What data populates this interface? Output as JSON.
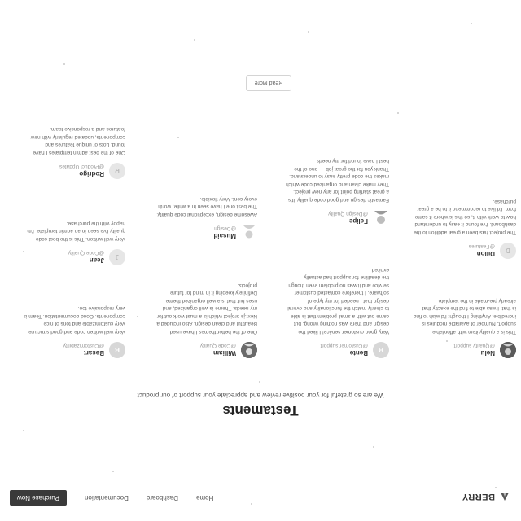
{
  "header": {
    "logo_text": "BERRY",
    "nav": [
      "Home",
      "Dashboard",
      "Documentation"
    ],
    "purchase_label": "Purchase Now"
  },
  "section": {
    "title": "Testaments",
    "subtitle": "We are so grateful for your positive review and appreciate your support of our product"
  },
  "testimonials": [
    {
      "initial": "",
      "name": "Nelu",
      "role": "@Quality support",
      "text": "This is a quality item with affordable support. Number of available modules is incredible. Anything I thought I'd wish to find is that. I was able to find the exactly that already pre-made in the template."
    },
    {
      "initial": "B",
      "name": "Bente",
      "role": "@Customer support",
      "text": "Very good customer service! I liked the design and there was nothing wrong, but came out with a small problem that is able to clearly match the functionality and overall design that I needed for my type of software. I therefore contacted customer service and it was no problem even though the deadline for support had actually expired."
    },
    {
      "initial": "",
      "name": "William",
      "role": "@Code Quality",
      "text": "One of the better themes I have used. Beautiful and clean design. Also included a Next.js project which is a must work out for my needs. Theme is well organized, and uses but that is a well organized theme. Definitely keeping it in mind for future projects."
    },
    {
      "initial": "B",
      "name": "Besart",
      "role": "@Customizability",
      "text": "Very well written code and good structure. Very customizable and tons of nice components. Good documentation. Team is very responsive too."
    },
    {
      "initial": "D",
      "name": "Dillon",
      "role": "@Features",
      "text": "The project has been a great addition to the dashboard. I've found it easy to understand how to work with it, so this is where it came from. I'd like to recommend it to be a great purchase."
    },
    {
      "initial": "",
      "name": "Felipe",
      "role": "@Design Quality",
      "text": "Fantastic design and good code quality. It's a great starting point for any new project. They make clean and organized code which makes the code pretty easy to understand. Thank you for the great job — one of the best I have found for my needs."
    },
    {
      "initial": "",
      "name": "Musaid",
      "role": "@Design",
      "text": "Awesome design, exceptional code quality. The best one I have seen in a while, worth every cent. Very flexible."
    },
    {
      "initial": "J",
      "name": "Jean",
      "role": "@Code Quality",
      "text": "Very well written. This is the best code quality I've seen in an admin template. I'm happy with the purchase."
    },
    {
      "initial": "R",
      "name": "Rodrigo",
      "role": "@Product Updates",
      "text": "One of the best admin templates I have found. Lots of unique features and components, updated regularly with new features and a responsive team."
    }
  ],
  "read_more_label": "Read More"
}
